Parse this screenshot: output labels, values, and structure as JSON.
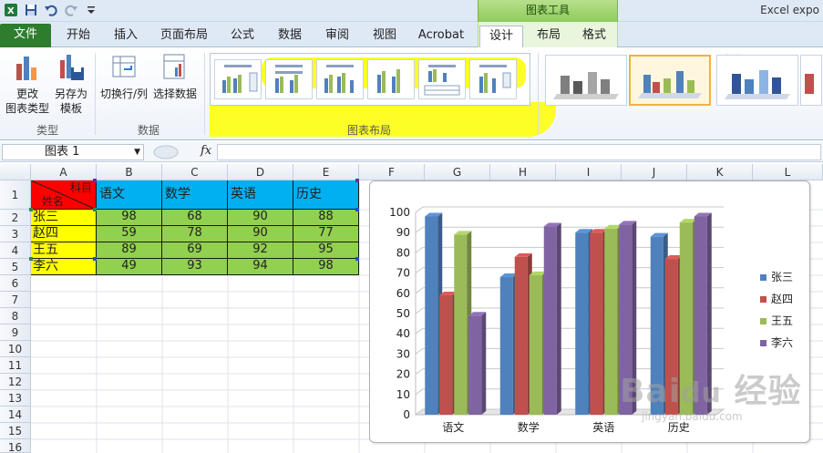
{
  "window": {
    "title": "Excel expo",
    "context_tab_group": "图表工具"
  },
  "tabs": [
    {
      "label": "文件"
    },
    {
      "label": "开始"
    },
    {
      "label": "插入"
    },
    {
      "label": "页面布局"
    },
    {
      "label": "公式"
    },
    {
      "label": "数据"
    },
    {
      "label": "审阅"
    },
    {
      "label": "视图"
    },
    {
      "label": "Acrobat"
    },
    {
      "label": "设计"
    },
    {
      "label": "布局"
    },
    {
      "label": "格式"
    }
  ],
  "ribbon": {
    "change_type": "更改\n图表类型",
    "change_type_l1": "更改",
    "change_type_l2": "图表类型",
    "save_template_l1": "另存为",
    "save_template_l2": "模板",
    "switch_row_col": "切换行/列",
    "select_data": "选择数据",
    "group_type": "类型",
    "group_data": "数据",
    "group_layout": "图表布局"
  },
  "formula_bar": {
    "name_box": "图表 1",
    "fx": "fx",
    "content": ""
  },
  "columns": [
    "A",
    "B",
    "C",
    "D",
    "E",
    "F",
    "G",
    "H",
    "I",
    "J",
    "K",
    "L"
  ],
  "rows": [
    "1",
    "2",
    "3",
    "4",
    "5",
    "6",
    "7",
    "8",
    "9",
    "10",
    "11",
    "12",
    "13",
    "14",
    "15",
    "16"
  ],
  "table": {
    "corner_top": "科目",
    "corner_bottom": "姓名",
    "headers": [
      "语文",
      "数学",
      "英语",
      "历史"
    ],
    "rows": [
      {
        "name": "张三",
        "values": [
          "98",
          "68",
          "90",
          "88"
        ]
      },
      {
        "name": "赵四",
        "values": [
          "59",
          "78",
          "90",
          "77"
        ]
      },
      {
        "name": "王五",
        "values": [
          "89",
          "69",
          "92",
          "95"
        ]
      },
      {
        "name": "李六",
        "values": [
          "49",
          "93",
          "94",
          "98"
        ]
      }
    ]
  },
  "chart_data": {
    "type": "bar",
    "categories": [
      "语文",
      "数学",
      "英语",
      "历史"
    ],
    "series": [
      {
        "name": "张三",
        "color": "#4f81bd",
        "values": [
          98,
          68,
          90,
          88
        ]
      },
      {
        "name": "赵四",
        "color": "#c0504d",
        "values": [
          59,
          78,
          90,
          77
        ]
      },
      {
        "name": "王五",
        "color": "#9bbb59",
        "values": [
          89,
          69,
          92,
          95
        ]
      },
      {
        "name": "李六",
        "color": "#8064a2",
        "values": [
          49,
          93,
          94,
          98
        ]
      }
    ],
    "ylim": [
      0,
      100
    ],
    "yticks": [
      "0",
      "10",
      "20",
      "30",
      "40",
      "50",
      "60",
      "70",
      "80",
      "90",
      "100"
    ],
    "grid": true,
    "legend_position": "right",
    "style": "3d-clustered-column"
  },
  "watermark": {
    "brand": "Bai du 经验",
    "url": "jingyan.baidu.com"
  }
}
